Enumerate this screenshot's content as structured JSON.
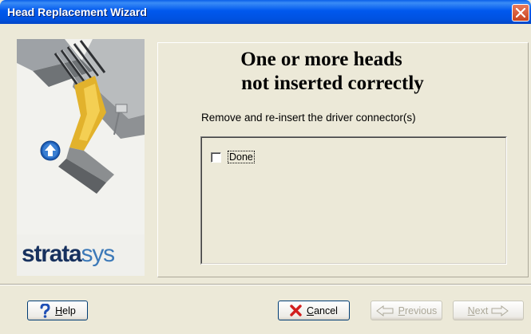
{
  "window": {
    "title": "Head Replacement Wizard",
    "close_icon": "close-icon"
  },
  "left_panel": {
    "logo_text_bold": "strata",
    "logo_text_light": "sys",
    "arrow_icon": "up-arrow-icon"
  },
  "content": {
    "heading_line1": "One or more heads",
    "heading_line2": "not inserted correctly",
    "instruction": "Remove and re-insert the driver connector(s)",
    "checkbox": {
      "label": "Done",
      "checked": false
    }
  },
  "buttons": {
    "help": {
      "label": "Help",
      "accesskey": "H",
      "rest": "elp",
      "icon": "question-icon",
      "enabled": true
    },
    "cancel": {
      "label": "Cancel",
      "accesskey": "C",
      "rest": "ancel",
      "icon": "x-icon",
      "enabled": true
    },
    "previous": {
      "label": "Previous",
      "accesskey": "P",
      "rest": "revious",
      "icon": "left-arrow-icon",
      "enabled": false
    },
    "next": {
      "label": "Next",
      "accesskey": "N",
      "rest": "ext",
      "icon": "right-arrow-icon",
      "enabled": false
    }
  },
  "colors": {
    "title_bar": "#0058EE",
    "window_bg": "#ECE9D8",
    "cancel_icon": "#D21F1F",
    "help_icon": "#1F4FB5",
    "logo_dark": "#17315E",
    "logo_light": "#3C79B8"
  }
}
